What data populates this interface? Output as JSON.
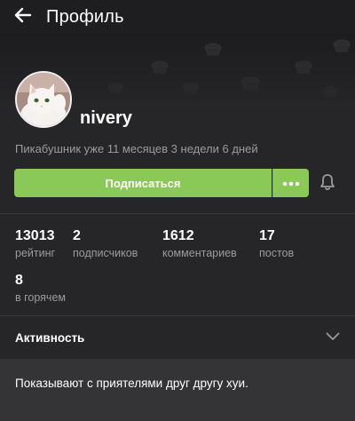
{
  "topbar": {
    "title": "Профиль",
    "back_icon": "arrow-left-icon"
  },
  "profile": {
    "username": "nivery",
    "member_since": "Пикабушник уже 11 месяцев 3 недели 6 дней",
    "avatar": "cat-avatar"
  },
  "actions": {
    "subscribe_label": "Подписаться",
    "more_icon": "more-dots-icon",
    "bell_icon": "bell-icon"
  },
  "stats": [
    {
      "value": "13013",
      "label": "рейтинг"
    },
    {
      "value": "2",
      "label": "подписчиков"
    },
    {
      "value": "1612",
      "label": "комментариев"
    },
    {
      "value": "17",
      "label": "постов"
    },
    {
      "value": "8",
      "label": "в горячем"
    }
  ],
  "activity": {
    "label": "Активность",
    "chevron_icon": "chevron-down-icon"
  },
  "bio": {
    "text": "Показывают с приятелями друг другу хуи."
  },
  "colors": {
    "background": "#262628",
    "topbar": "#1e1e20",
    "accent_green": "#8ac858",
    "secondary_text": "#9b9b9f",
    "bio_card": "#343437"
  }
}
